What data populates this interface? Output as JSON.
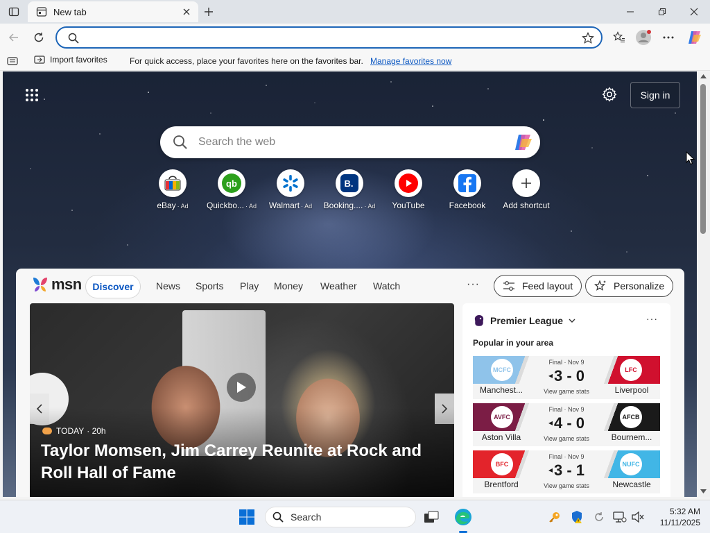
{
  "browser": {
    "tab_title": "New tab",
    "omnibox_value": "",
    "favorites_bar": {
      "import_label": "Import favorites",
      "message": "For quick access, place your favorites here on the favorites bar.",
      "manage_link": "Manage favorites now"
    }
  },
  "newtab": {
    "signin_label": "Sign in",
    "search_placeholder": "Search the web",
    "shortcuts": [
      {
        "label": "eBay",
        "ad": "· Ad",
        "icon": "ebay-icon"
      },
      {
        "label": "Quickbo...",
        "ad": "· Ad",
        "icon": "quickbooks-icon"
      },
      {
        "label": "Walmart",
        "ad": "· Ad",
        "icon": "walmart-icon"
      },
      {
        "label": "Booking....",
        "ad": "· Ad",
        "icon": "booking-icon"
      },
      {
        "label": "YouTube",
        "ad": "",
        "icon": "youtube-icon"
      },
      {
        "label": "Facebook",
        "ad": "",
        "icon": "facebook-icon"
      },
      {
        "label": "Add shortcut",
        "ad": "",
        "icon": "plus-icon"
      }
    ]
  },
  "feed": {
    "logo": "msn",
    "tabs": [
      "Discover",
      "News",
      "Sports",
      "Play",
      "Money",
      "Weather",
      "Watch"
    ],
    "more": "···",
    "feed_layout_label": "Feed layout",
    "personalize_label": "Personalize",
    "hero": {
      "source": "TODAY",
      "age": "· 20h",
      "title": "Taylor Momsen, Jim Carrey Reunite at Rock and Roll Hall of Fame"
    },
    "premier_league": {
      "title": "Premier League",
      "subtitle": "Popular in your area",
      "more": "···",
      "matches": [
        {
          "status": "Final · Nov 9",
          "score": "3 - 0",
          "stats": "View game stats",
          "home": "Manchest...",
          "away": "Liverpool",
          "home_color": "#8fc3ea",
          "away_color": "#d0102e",
          "home_abbr": "MCFC",
          "away_abbr": "LFC"
        },
        {
          "status": "Final · Nov 9",
          "score": "4 - 0",
          "stats": "View game stats",
          "home": "Aston Villa",
          "away": "Bournem...",
          "home_color": "#7b1d45",
          "away_color": "#1a1a1a",
          "home_abbr": "AVFC",
          "away_abbr": "AFCB"
        },
        {
          "status": "Final · Nov 9",
          "score": "3 - 1",
          "stats": "View game stats",
          "home": "Brentford",
          "away": "Newcastle",
          "home_color": "#e3242b",
          "away_color": "#41b6e6",
          "home_abbr": "BFC",
          "away_abbr": "NUFC"
        }
      ]
    }
  },
  "taskbar": {
    "search_label": "Search",
    "time": "5:32 AM",
    "date": "11/11/2025"
  }
}
